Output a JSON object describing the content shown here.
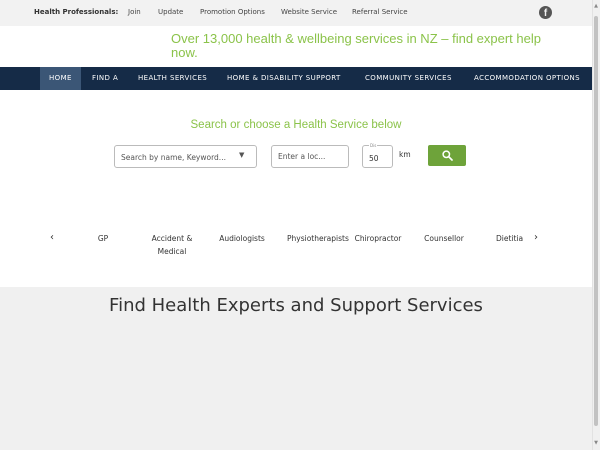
{
  "topbar": {
    "label": "Health Professionals:",
    "links": [
      "Join",
      "Update",
      "Promotion Options",
      "Website Service",
      "Referral Service"
    ],
    "social_icon": "facebook-icon",
    "social_glyph": "f"
  },
  "tagline": "Over 13,000 health & wellbeing services in NZ – find expert help now.",
  "nav": {
    "items": [
      "Home",
      "Find A",
      "Health Services",
      "Home & Disability Support",
      "Community Services",
      "Accommodation Options"
    ],
    "active": "Home"
  },
  "search": {
    "title": "Search or choose a Health Service below",
    "select_text": "Search by name, Keyword...",
    "location_placeholder": "Enter a loc...",
    "distance_label": "Dis",
    "distance_value": "50",
    "distance_unit": "km",
    "button_icon": "search-icon"
  },
  "carousel": {
    "prev": "‹",
    "next": "›",
    "items": [
      "GP",
      "Accident & Medical",
      "Audiologists",
      "Physiotherapists",
      "Chiropractor",
      "Counsellor",
      "Dietitia"
    ]
  },
  "lower": {
    "heading": "Find Health Experts and Support Services"
  },
  "colors": {
    "accent_green": "#8bc34a",
    "button_green": "#6ea33a",
    "nav_bg": "#152b47",
    "nav_active": "#3b5676",
    "lower_bg": "#f0f0f0"
  }
}
